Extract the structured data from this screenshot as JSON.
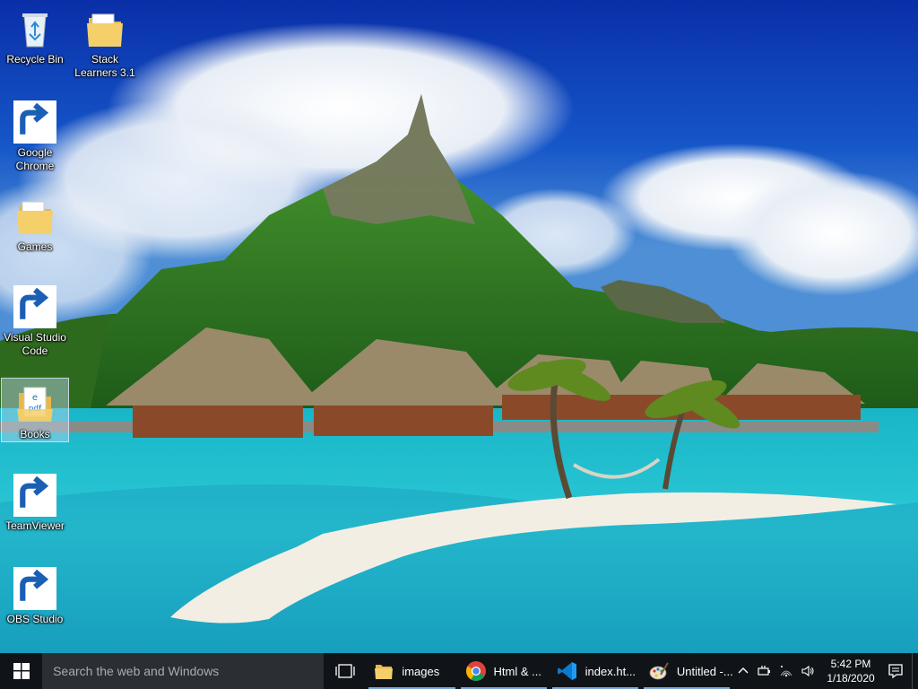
{
  "desktop": {
    "wallpaper": "tropical island with overwater bungalows and mountain",
    "icons": [
      {
        "label": "Recycle Bin",
        "icon": "recycle-bin-icon",
        "shortcut": false,
        "selected": false
      },
      {
        "label": "Stack\nLearners 3.1",
        "icon": "folder-icon",
        "shortcut": false,
        "selected": false
      },
      {
        "label": "Google\nChrome",
        "icon": "chrome-icon",
        "shortcut": true,
        "selected": false
      },
      {
        "label": "Games",
        "icon": "folder-icon",
        "shortcut": false,
        "selected": false
      },
      {
        "label": "Visual Studio\nCode",
        "icon": "vscode-icon",
        "shortcut": true,
        "selected": false
      },
      {
        "label": "Books",
        "icon": "pdf-folder-icon",
        "shortcut": false,
        "selected": true
      },
      {
        "label": "TeamViewer",
        "icon": "teamviewer-icon",
        "shortcut": true,
        "selected": false
      },
      {
        "label": "OBS Studio",
        "icon": "obs-icon",
        "shortcut": true,
        "selected": false
      }
    ]
  },
  "taskbar": {
    "search_placeholder": "Search the web and Windows",
    "apps": [
      {
        "label": "images",
        "icon": "folder-icon",
        "active": false
      },
      {
        "label": "Html & ...",
        "icon": "chrome-icon",
        "active": false
      },
      {
        "label": "index.ht...",
        "icon": "vscode-icon",
        "active": false
      },
      {
        "label": "Untitled -...",
        "icon": "paint-icon",
        "active": false
      }
    ],
    "tray": {
      "time": "5:42 PM",
      "date": "1/18/2020"
    }
  },
  "colors": {
    "taskbar_bg": "#101418",
    "search_bg": "#2b2f34",
    "running_indicator": "#7da7d9"
  }
}
